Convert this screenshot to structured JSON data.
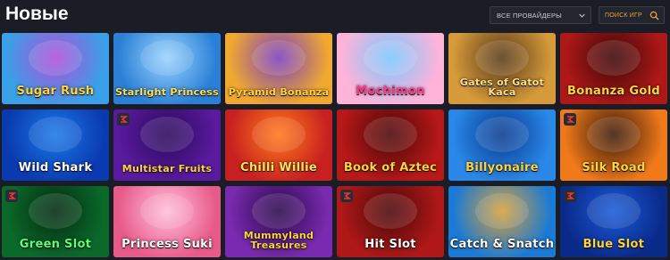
{
  "header": {
    "title": "Новые",
    "provider_select": {
      "selected": "ВСЕ ПРОВАЙДЕРЫ"
    },
    "search": {
      "placeholder": "ПОИСК ИГР"
    }
  },
  "colors": {
    "background": "#1a1d26",
    "accent": "#e8a13a"
  },
  "games": [
    {
      "title": "Sugar Rush",
      "bg": [
        "#3aa0e8",
        "#b04fd6"
      ],
      "text_color": "#ffd23f",
      "badge": false
    },
    {
      "title": "Starlight Princess",
      "bg": [
        "#2a7fd6",
        "#9bd3ff"
      ],
      "text_color": "#ffe15a",
      "badge": false
    },
    {
      "title": "Pyramid Bonanza",
      "bg": [
        "#f0a830",
        "#7a3fc0"
      ],
      "text_color": "#ffd23f",
      "badge": false
    },
    {
      "title": "Mochimon",
      "bg": [
        "#ffb3d9",
        "#7ac8ff"
      ],
      "text_color": "#ff3d8a",
      "badge": false
    },
    {
      "title": "Gates of Gatot Kaca",
      "bg": [
        "#d69a3a",
        "#5a3a1a"
      ],
      "text_color": "#ffe08a",
      "badge": false
    },
    {
      "title": "Bonanza Gold",
      "bg": [
        "#b01818",
        "#3a0808"
      ],
      "text_color": "#ffd23f",
      "badge": false
    },
    {
      "title": "Wild Shark",
      "bg": [
        "#0a3ab0",
        "#1a78e8"
      ],
      "text_color": "#ffffff",
      "badge": false
    },
    {
      "title": "Multistar Fruits",
      "bg": [
        "#5a1aa0",
        "#2a0a5a"
      ],
      "text_color": "#ffd23f",
      "badge": true
    },
    {
      "title": "Chilli Willie",
      "bg": [
        "#c82020",
        "#ff7a1a"
      ],
      "text_color": "#ffe15a",
      "badge": false
    },
    {
      "title": "Book of Aztec",
      "bg": [
        "#b81818",
        "#4a0808"
      ],
      "text_color": "#ffd23f",
      "badge": false
    },
    {
      "title": "Billyonaire",
      "bg": [
        "#2a88e8",
        "#0a3a90"
      ],
      "text_color": "#ffd23f",
      "badge": false
    },
    {
      "title": "Silk Road",
      "bg": [
        "#f07a1a",
        "#3a1a0a"
      ],
      "text_color": "#ffd23f",
      "badge": true
    },
    {
      "title": "Green Slot",
      "bg": [
        "#0a6a2a",
        "#042a12"
      ],
      "text_color": "#5aff7a",
      "badge": true
    },
    {
      "title": "Princess Suki",
      "bg": [
        "#e85a8a",
        "#ffc0d8"
      ],
      "text_color": "#ffffff",
      "badge": false
    },
    {
      "title": "Mummyland Treasures",
      "bg": [
        "#7a2ab0",
        "#2a0a4a"
      ],
      "text_color": "#ffd23f",
      "badge": false
    },
    {
      "title": "Hit Slot",
      "bg": [
        "#b01818",
        "#4a0808"
      ],
      "text_color": "#ffffff",
      "badge": true
    },
    {
      "title": "Catch & Snatch",
      "bg": [
        "#1a7ad6",
        "#d6a03a"
      ],
      "text_color": "#ffffff",
      "badge": false
    },
    {
      "title": "Blue Slot",
      "bg": [
        "#0a2a8a",
        "#1a5ad6"
      ],
      "text_color": "#ffd23f",
      "badge": true
    }
  ]
}
